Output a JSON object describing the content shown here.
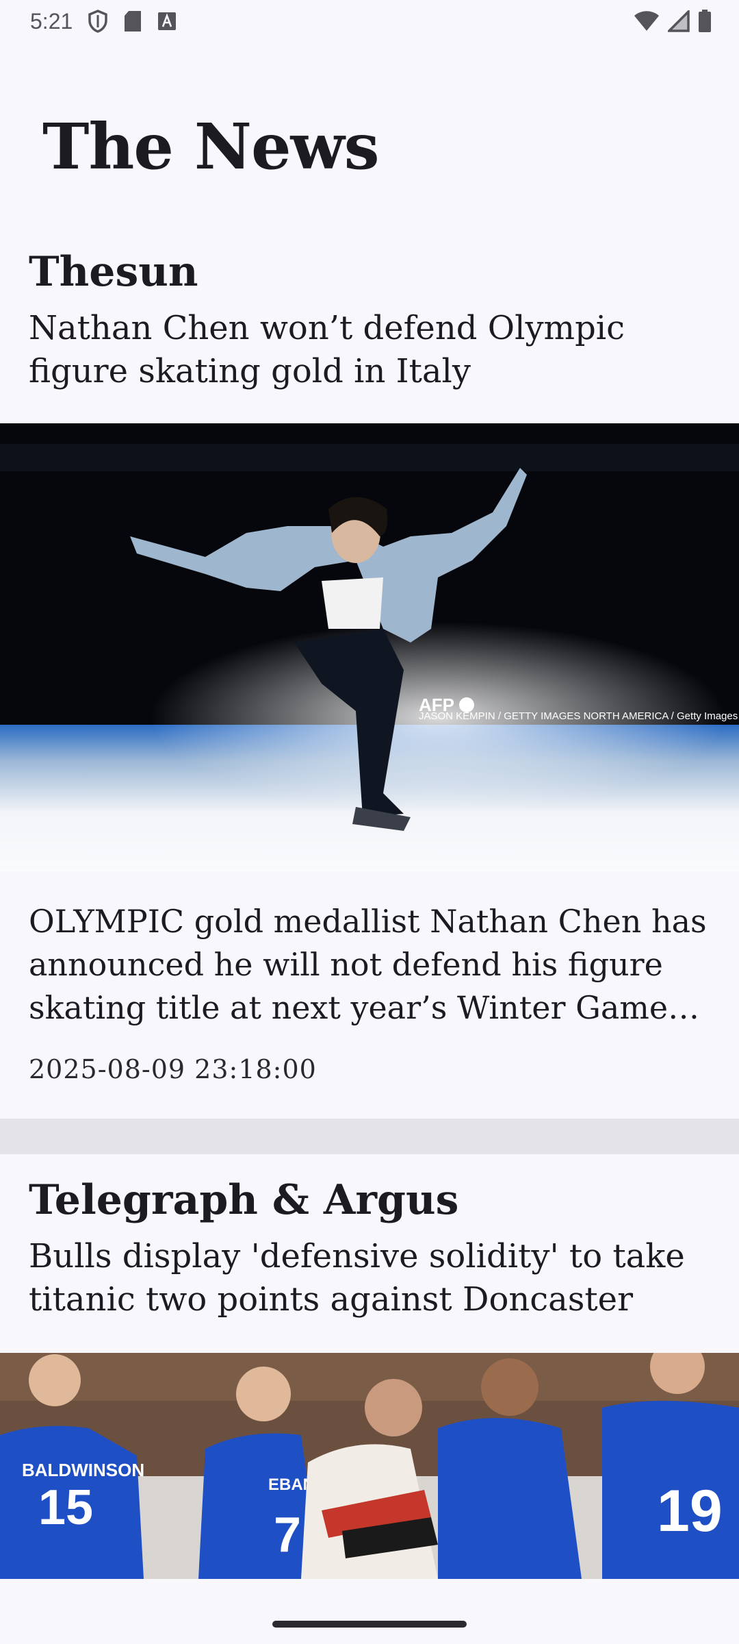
{
  "status_bar": {
    "time": "5:21",
    "left_icons": [
      "shield-icon",
      "sd-card-icon",
      "keyboard-a-icon"
    ],
    "right_icons": [
      "wifi-icon",
      "cell-signal-icon",
      "battery-icon"
    ]
  },
  "app": {
    "title": "The News"
  },
  "articles": [
    {
      "source": "Thesun",
      "headline": "Nathan Chen won’t defend Olympic figure skating gold in Italy",
      "image_credit_logo": "AFP",
      "image_credit": "JASON KEMPIN / GETTY IMAGES NORTH AMERICA / Getty Images",
      "summary": "OLYMPIC gold medallist Nathan Chen has announced he will not defend his figure skating title at next year’s Winter Games in…",
      "published": "2025-08-09 23:18:00"
    },
    {
      "source": "Telegraph & Argus",
      "headline": "Bulls display 'defensive solidity' to take titanic two points against Doncaster",
      "jersey_name_1": "BALDWINSON",
      "jersey_number_1": "15",
      "jersey_name_2": "EBANSON",
      "jersey_number_2": "7",
      "jersey_number_3": "19"
    }
  ],
  "colors": {
    "background": "#f8f7fc",
    "separator": "#e4e3ea",
    "text": "#1c1b1f",
    "jersey_blue": "#1f4fc4"
  }
}
